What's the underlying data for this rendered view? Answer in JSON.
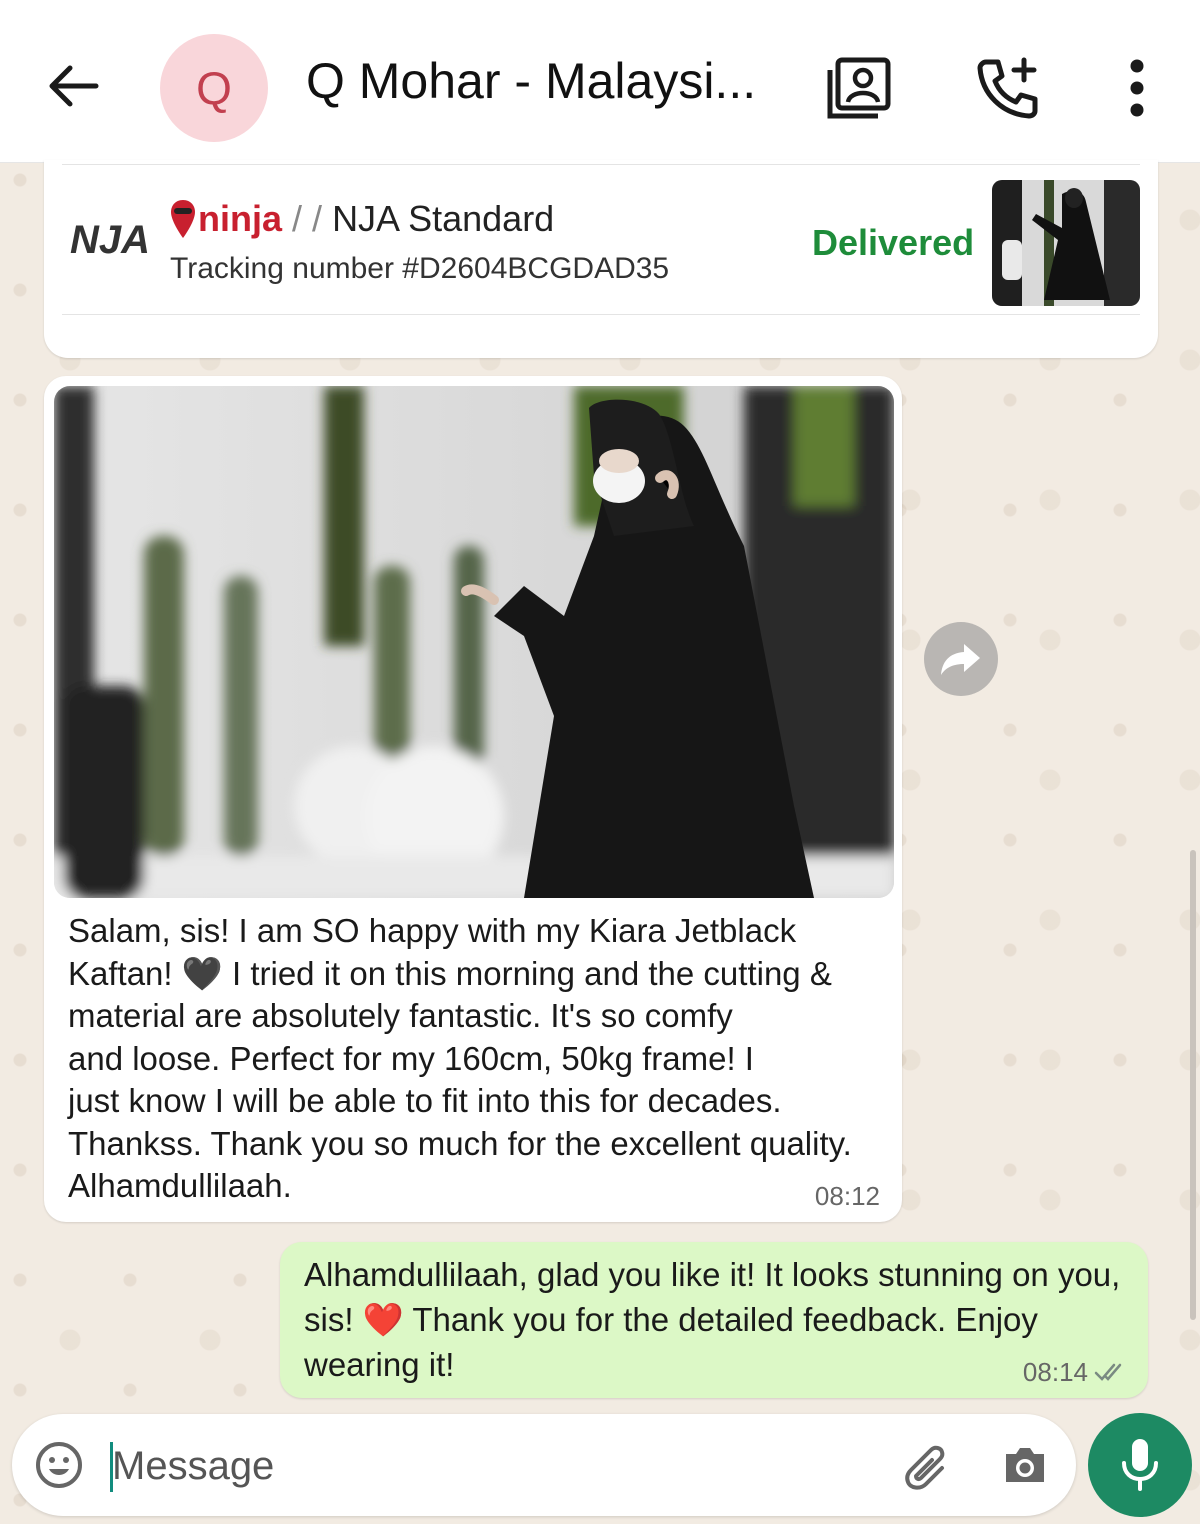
{
  "header": {
    "avatar_letter": "Q",
    "contact_name": "Q Mohar - Malaysi..."
  },
  "delivery": {
    "courier_logo": "NJA",
    "courier_brand": "ninja",
    "courier_separator": "/ /",
    "service": "NJA Standard",
    "tracking": "Tracking number #D2604BCGDAD35",
    "status": "Delivered"
  },
  "incoming": {
    "lines": [
      "Salam, sis! I am SO happy with my Kiara Jetblack",
      "Kaftan! 🖤 I tried it on this morning and the cutting &",
      "material are absolutely fantastic. It's so comfy",
      "and loose. Perfect for my 160cm, 50kg frame! I",
      "just know I will be able to fit into this for decades.",
      "Thankss. Thank you so much for the excellent quality.",
      "Alhamdullilaah."
    ],
    "time": "08:12"
  },
  "outgoing": {
    "lines": [
      "Alhamdullilaah, glad you like it! It looks stunning on you,",
      "sis! ❤️ Thank you for the detailed feedback. Enjoy",
      "wearing it!"
    ],
    "time": "08:14"
  },
  "input": {
    "placeholder": "Message"
  },
  "colors": {
    "accent": "#1d8a63",
    "delivered": "#1e8c3a",
    "outgoing_bubble": "#dcf8c6",
    "avatar_bg": "#f9d6da"
  },
  "icons": [
    "back-arrow-icon",
    "contact-card-icon",
    "add-call-icon",
    "more-vert-icon",
    "forward-icon",
    "emoji-icon",
    "attach-icon",
    "camera-icon",
    "mic-icon",
    "double-check-icon"
  ]
}
